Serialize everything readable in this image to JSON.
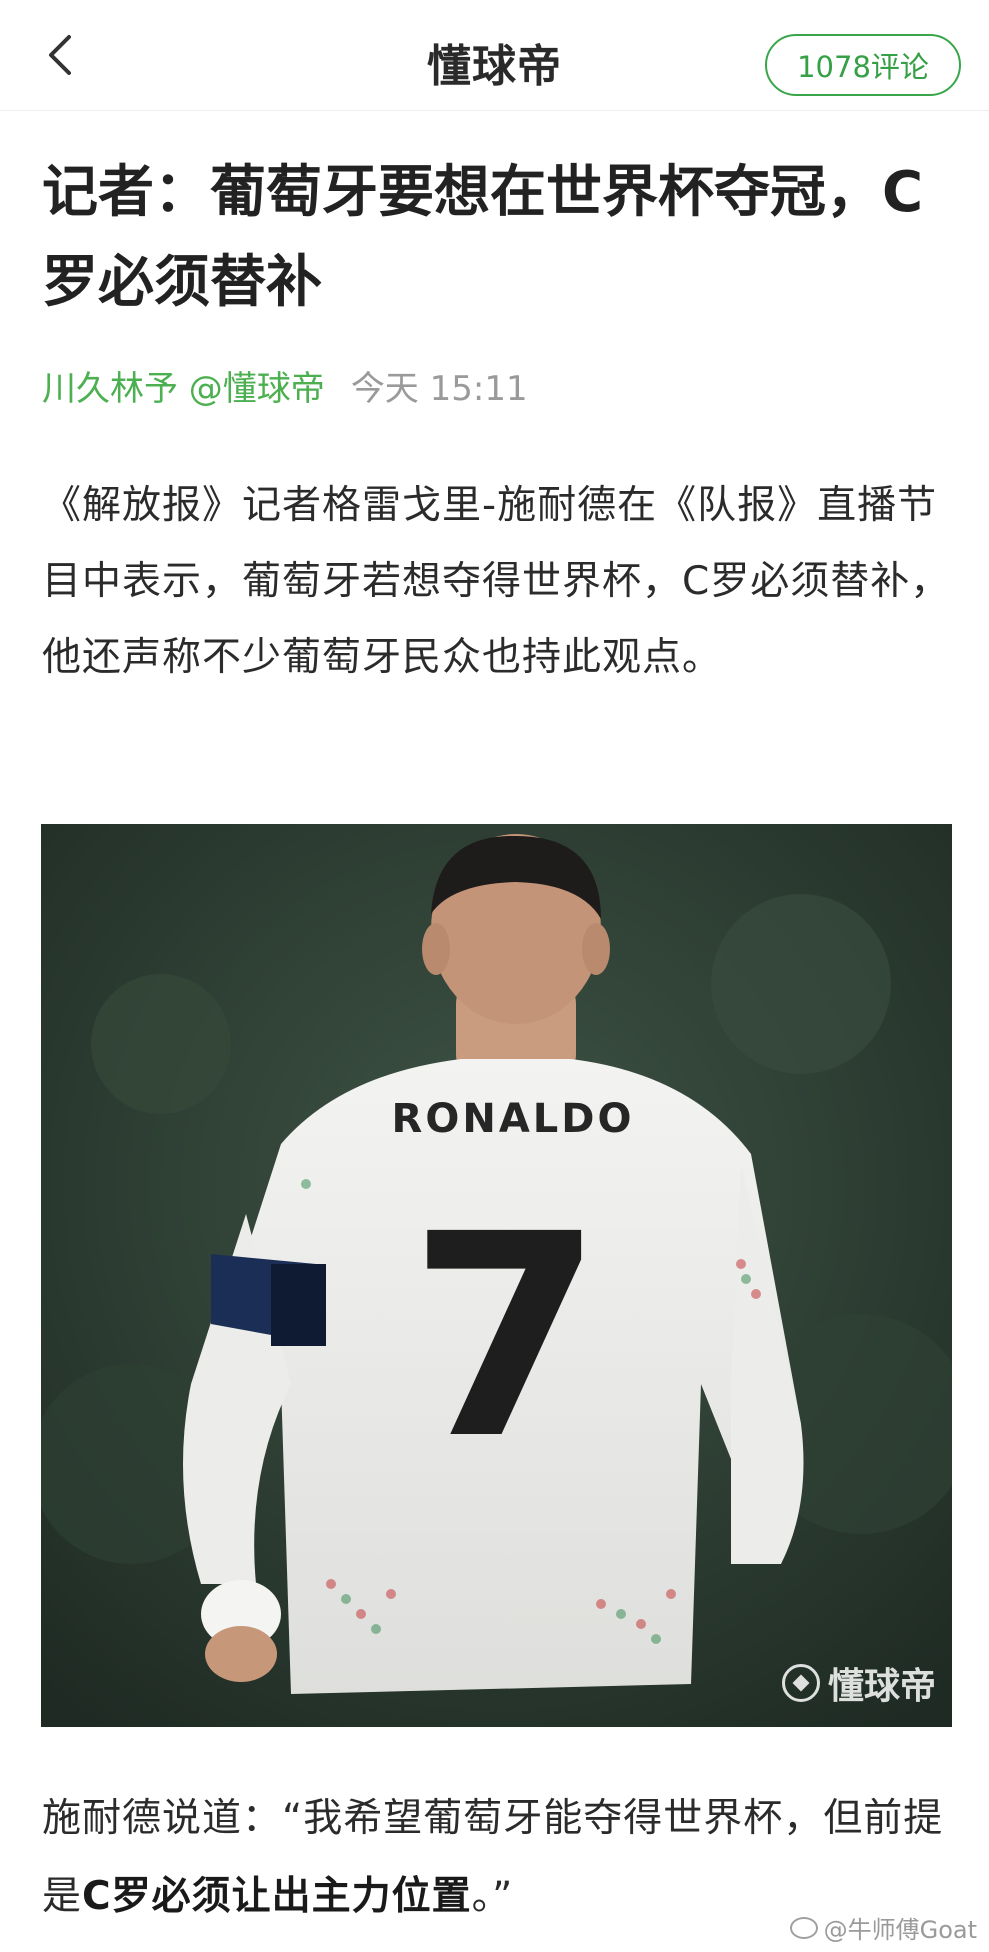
{
  "header": {
    "back_icon": "chevron-left-icon",
    "title": "懂球帝",
    "comments_label": "1078评论",
    "accent_color": "#3aa64a"
  },
  "article": {
    "headline": "记者：葡萄牙要想在世界杯夺冠，C罗必须替补",
    "author": "川久林予 @懂球帝",
    "time": "今天 15:11",
    "paragraph1": "《解放报》记者格雷戈里-施耐德在《队报》直播节目中表示，葡萄牙若想夺得世界杯，C罗必须替补，他还声称不少葡萄牙民众也持此观点。",
    "photo": {
      "jersey_name": "RONALDO",
      "jersey_number": "7",
      "watermark": "懂球帝"
    },
    "paragraph2_prefix": "施耐德说道：“我希望葡萄牙能夺得世界杯，但前提是",
    "paragraph2_bold": "C罗必须让出主力位置",
    "paragraph2_suffix": "。”"
  },
  "overlay": {
    "weibo_watermark": "@牛师傅Goat"
  }
}
